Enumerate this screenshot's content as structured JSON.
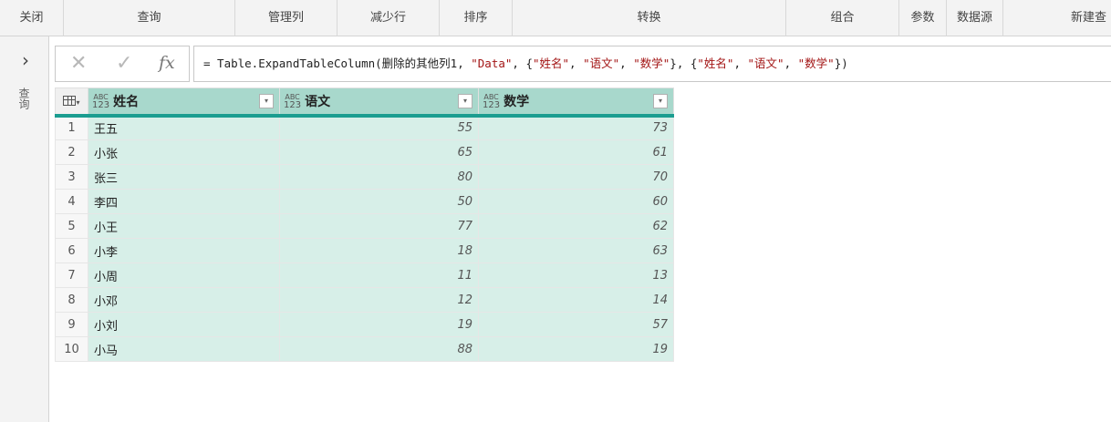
{
  "ribbon": {
    "groups": [
      "关闭",
      "查询",
      "管理列",
      "减少行",
      "排序",
      "转换",
      "组合",
      "参数",
      "数据源",
      "新建查"
    ]
  },
  "queries_pane": {
    "label": "查询"
  },
  "formula_bar": {
    "cancel_icon": "✕",
    "commit_icon": "✓",
    "fx_label": "fx",
    "formula": {
      "p1": "= Table.ExpandTableColumn(删除的其他列1, ",
      "s1": "\"Data\"",
      "p2": ", {",
      "s2": "\"姓名\"",
      "p3": ", ",
      "s3": "\"语文\"",
      "p4": ", ",
      "s4": "\"数学\"",
      "p5": "}, {",
      "s5": "\"姓名\"",
      "p6": ", ",
      "s6": "\"语文\"",
      "p7": ", ",
      "s7": "\"数学\"",
      "p8": "})"
    }
  },
  "table": {
    "type_top": "ABC",
    "type_bottom": "123",
    "columns": [
      "姓名",
      "语文",
      "数学"
    ],
    "rows": [
      {
        "n": "1",
        "name": "王五",
        "chinese": "55",
        "math": "73"
      },
      {
        "n": "2",
        "name": "小张",
        "chinese": "65",
        "math": "61"
      },
      {
        "n": "3",
        "name": "张三",
        "chinese": "80",
        "math": "70"
      },
      {
        "n": "4",
        "name": "李四",
        "chinese": "50",
        "math": "60"
      },
      {
        "n": "5",
        "name": "小王",
        "chinese": "77",
        "math": "62"
      },
      {
        "n": "6",
        "name": "小李",
        "chinese": "18",
        "math": "63"
      },
      {
        "n": "7",
        "name": "小周",
        "chinese": "11",
        "math": "13"
      },
      {
        "n": "8",
        "name": "小邓",
        "chinese": "12",
        "math": "14"
      },
      {
        "n": "9",
        "name": "小刘",
        "chinese": "19",
        "math": "57"
      },
      {
        "n": "10",
        "name": "小马",
        "chinese": "88",
        "math": "19"
      }
    ]
  }
}
